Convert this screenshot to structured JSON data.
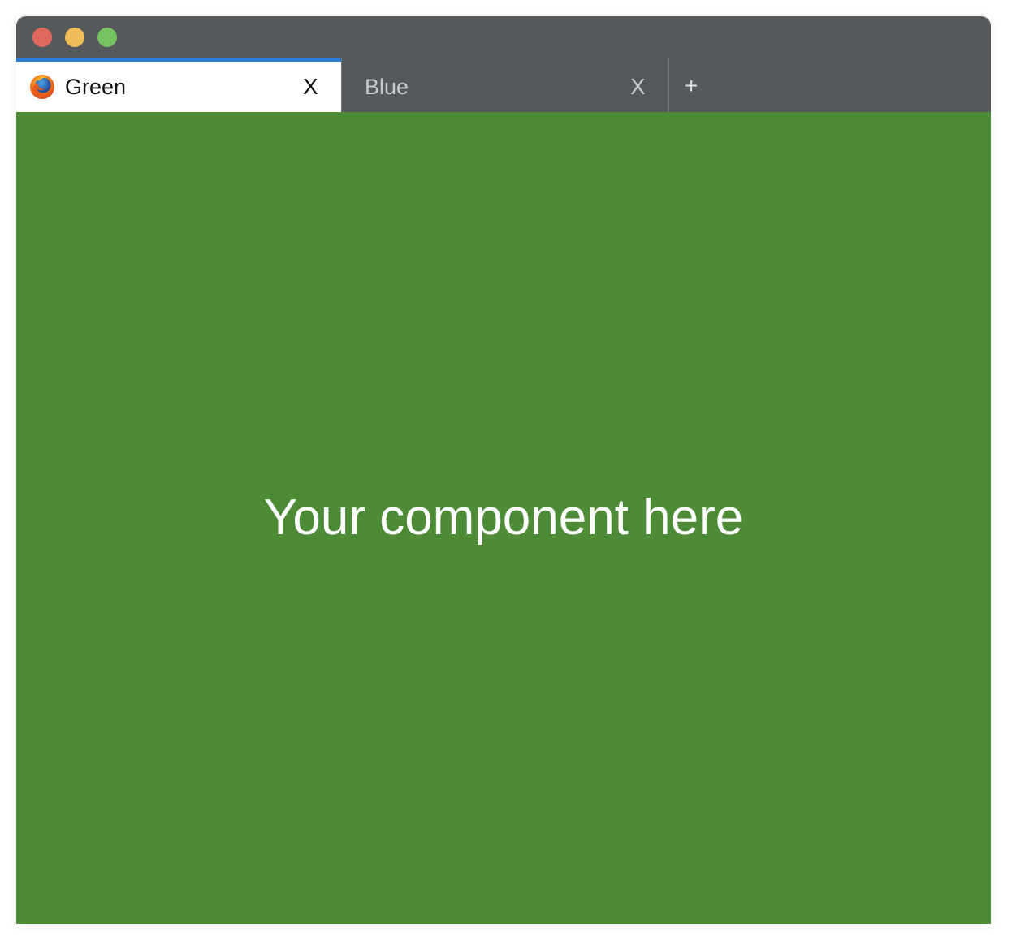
{
  "window": {
    "traffic_lights": [
      {
        "name": "close",
        "color": "#e0685e"
      },
      {
        "name": "minimize",
        "color": "#f0bd58"
      },
      {
        "name": "zoom",
        "color": "#76c35f"
      }
    ]
  },
  "tabs": [
    {
      "label": "Green",
      "close_label": "X",
      "icon": "firefox-icon",
      "active": true
    },
    {
      "label": "Blue",
      "close_label": "X",
      "active": false
    }
  ],
  "new_tab_label": "+",
  "content": {
    "text": "Your component here",
    "background": "#4d8b37"
  },
  "colors": {
    "chrome": "#55595c",
    "active_tab_indicator": "#2e7cd6",
    "active_tab_bg": "#ffffff"
  }
}
